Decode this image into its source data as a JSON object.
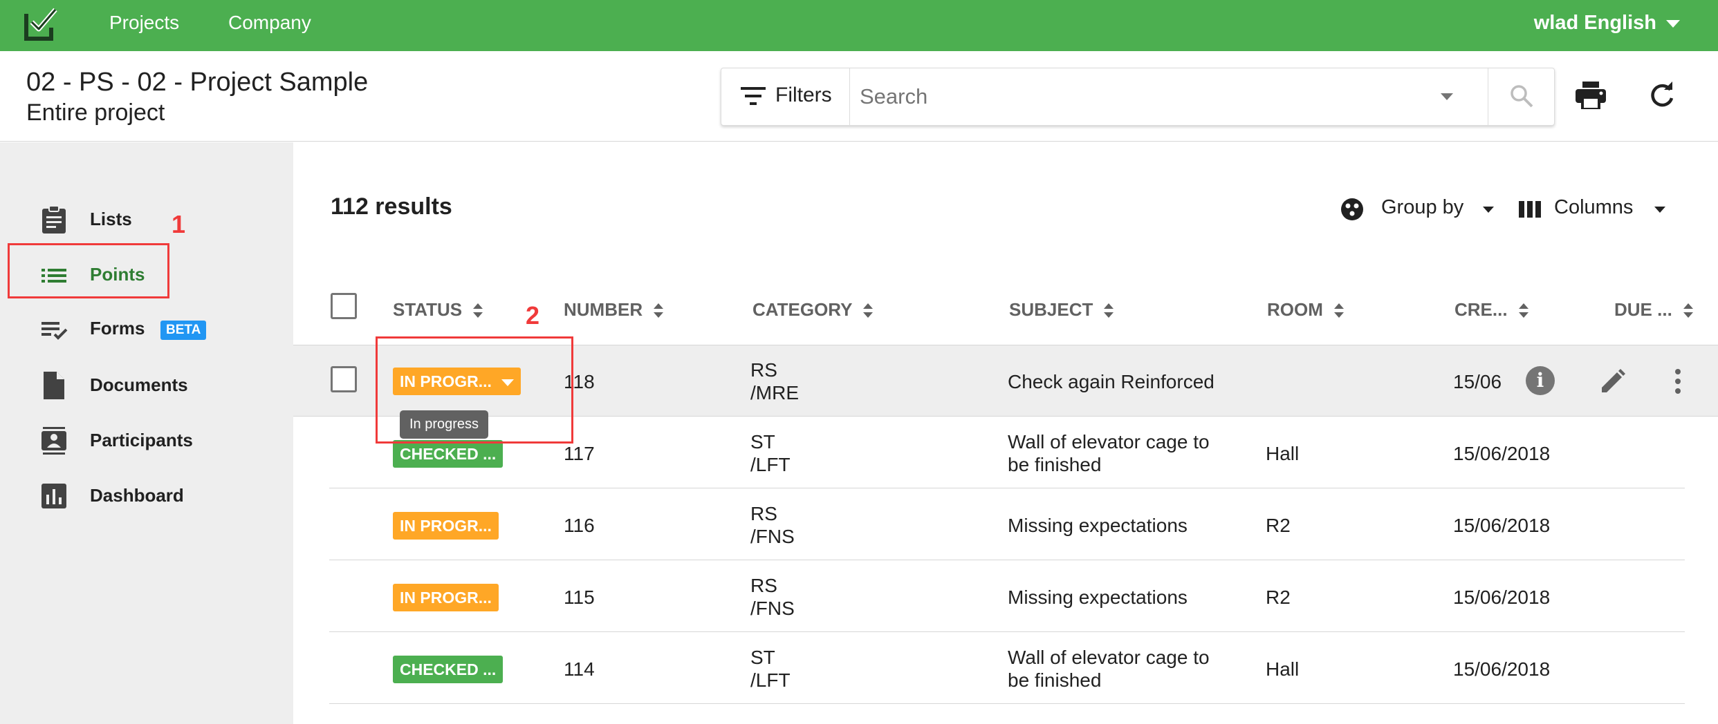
{
  "topbar": {
    "nav": [
      "Projects",
      "Company"
    ],
    "user": "wlad English"
  },
  "header": {
    "title": "02 - PS - 02 - Project Sample",
    "subtitle": "Entire project",
    "filters_label": "Filters",
    "search_placeholder": "Search"
  },
  "sidebar": {
    "items": [
      {
        "label": "Lists",
        "icon": "clipboard-icon"
      },
      {
        "label": "Points",
        "icon": "list-icon",
        "active": true
      },
      {
        "label": "Forms",
        "icon": "checklist-icon",
        "badge": "BETA"
      },
      {
        "label": "Documents",
        "icon": "document-icon"
      },
      {
        "label": "Participants",
        "icon": "participants-icon"
      },
      {
        "label": "Dashboard",
        "icon": "dashboard-icon"
      }
    ]
  },
  "annotations": {
    "first": "1",
    "second": "2"
  },
  "main": {
    "results": "112 results",
    "group_by": "Group by",
    "columns": "Columns",
    "headers": [
      "STATUS",
      "NUMBER",
      "CATEGORY",
      "SUBJECT",
      "ROOM",
      "CRE...",
      "DUE ..."
    ],
    "rows": [
      {
        "status": "IN PROGR...",
        "status_color": "orange",
        "number": "118",
        "category": [
          "RS",
          "/MRE"
        ],
        "subject": [
          "Check again Reinforced"
        ],
        "room": "",
        "created": "15/06",
        "due": ""
      },
      {
        "status": "CHECKED ...",
        "status_color": "green",
        "number": "117",
        "category": [
          "ST",
          "/LFT"
        ],
        "subject": [
          "Wall of elevator cage to",
          "be finished"
        ],
        "room": "Hall",
        "created": "15/06/2018",
        "due": ""
      },
      {
        "status": "IN PROGR...",
        "status_color": "orange",
        "number": "116",
        "category": [
          "RS",
          "/FNS"
        ],
        "subject": [
          "Missing expectations"
        ],
        "room": "R2",
        "created": "15/06/2018",
        "due": ""
      },
      {
        "status": "IN PROGR...",
        "status_color": "orange",
        "number": "115",
        "category": [
          "RS",
          "/FNS"
        ],
        "subject": [
          "Missing expectations"
        ],
        "room": "R2",
        "created": "15/06/2018",
        "due": ""
      },
      {
        "status": "CHECKED ...",
        "status_color": "green",
        "number": "114",
        "category": [
          "ST",
          "/LFT"
        ],
        "subject": [
          "Wall of elevator cage to",
          "be finished"
        ],
        "room": "Hall",
        "created": "15/06/2018",
        "due": ""
      }
    ],
    "tooltip": "In progress"
  },
  "colors": {
    "brand_green": "#4caf50",
    "in_progress": "#ffa726",
    "checked": "#4caf50",
    "annotation_red": "#f03a3a",
    "beta_blue": "#2196f3"
  }
}
